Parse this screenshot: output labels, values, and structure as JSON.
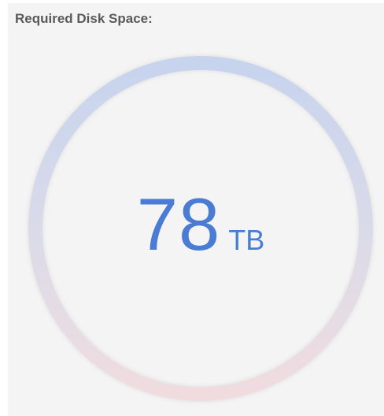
{
  "panel": {
    "title": "Required Disk Space:"
  },
  "disk_space": {
    "value": "78",
    "unit": "TB"
  },
  "colors": {
    "accent": "#4a7cd3",
    "ring_top": "#c7d4ee",
    "ring_bottom": "#f0dcdf",
    "panel_background": "#f4f4f4",
    "title": "#5a5a5a"
  }
}
